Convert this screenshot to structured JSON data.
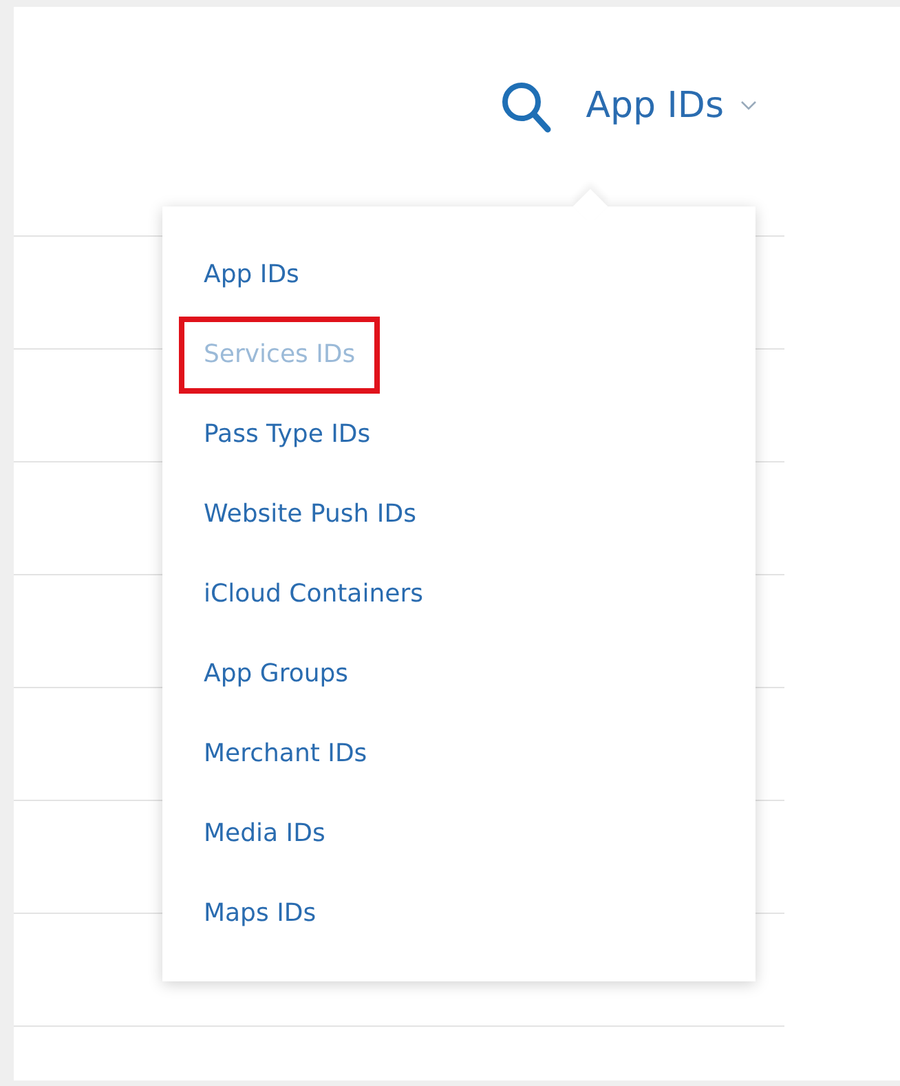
{
  "header": {
    "filter": {
      "label": "App IDs",
      "expanded": true
    }
  },
  "menu": {
    "items": [
      {
        "label": "App IDs",
        "selected": false,
        "outlined": false
      },
      {
        "label": "Services IDs",
        "selected": true,
        "outlined": true
      },
      {
        "label": "Pass Type IDs",
        "selected": false,
        "outlined": false
      },
      {
        "label": "Website Push IDs",
        "selected": false,
        "outlined": false
      },
      {
        "label": "iCloud Containers",
        "selected": false,
        "outlined": false
      },
      {
        "label": "App Groups",
        "selected": false,
        "outlined": false
      },
      {
        "label": "Merchant IDs",
        "selected": false,
        "outlined": false
      },
      {
        "label": "Media IDs",
        "selected": false,
        "outlined": false
      },
      {
        "label": "Maps IDs",
        "selected": false,
        "outlined": false
      }
    ]
  }
}
